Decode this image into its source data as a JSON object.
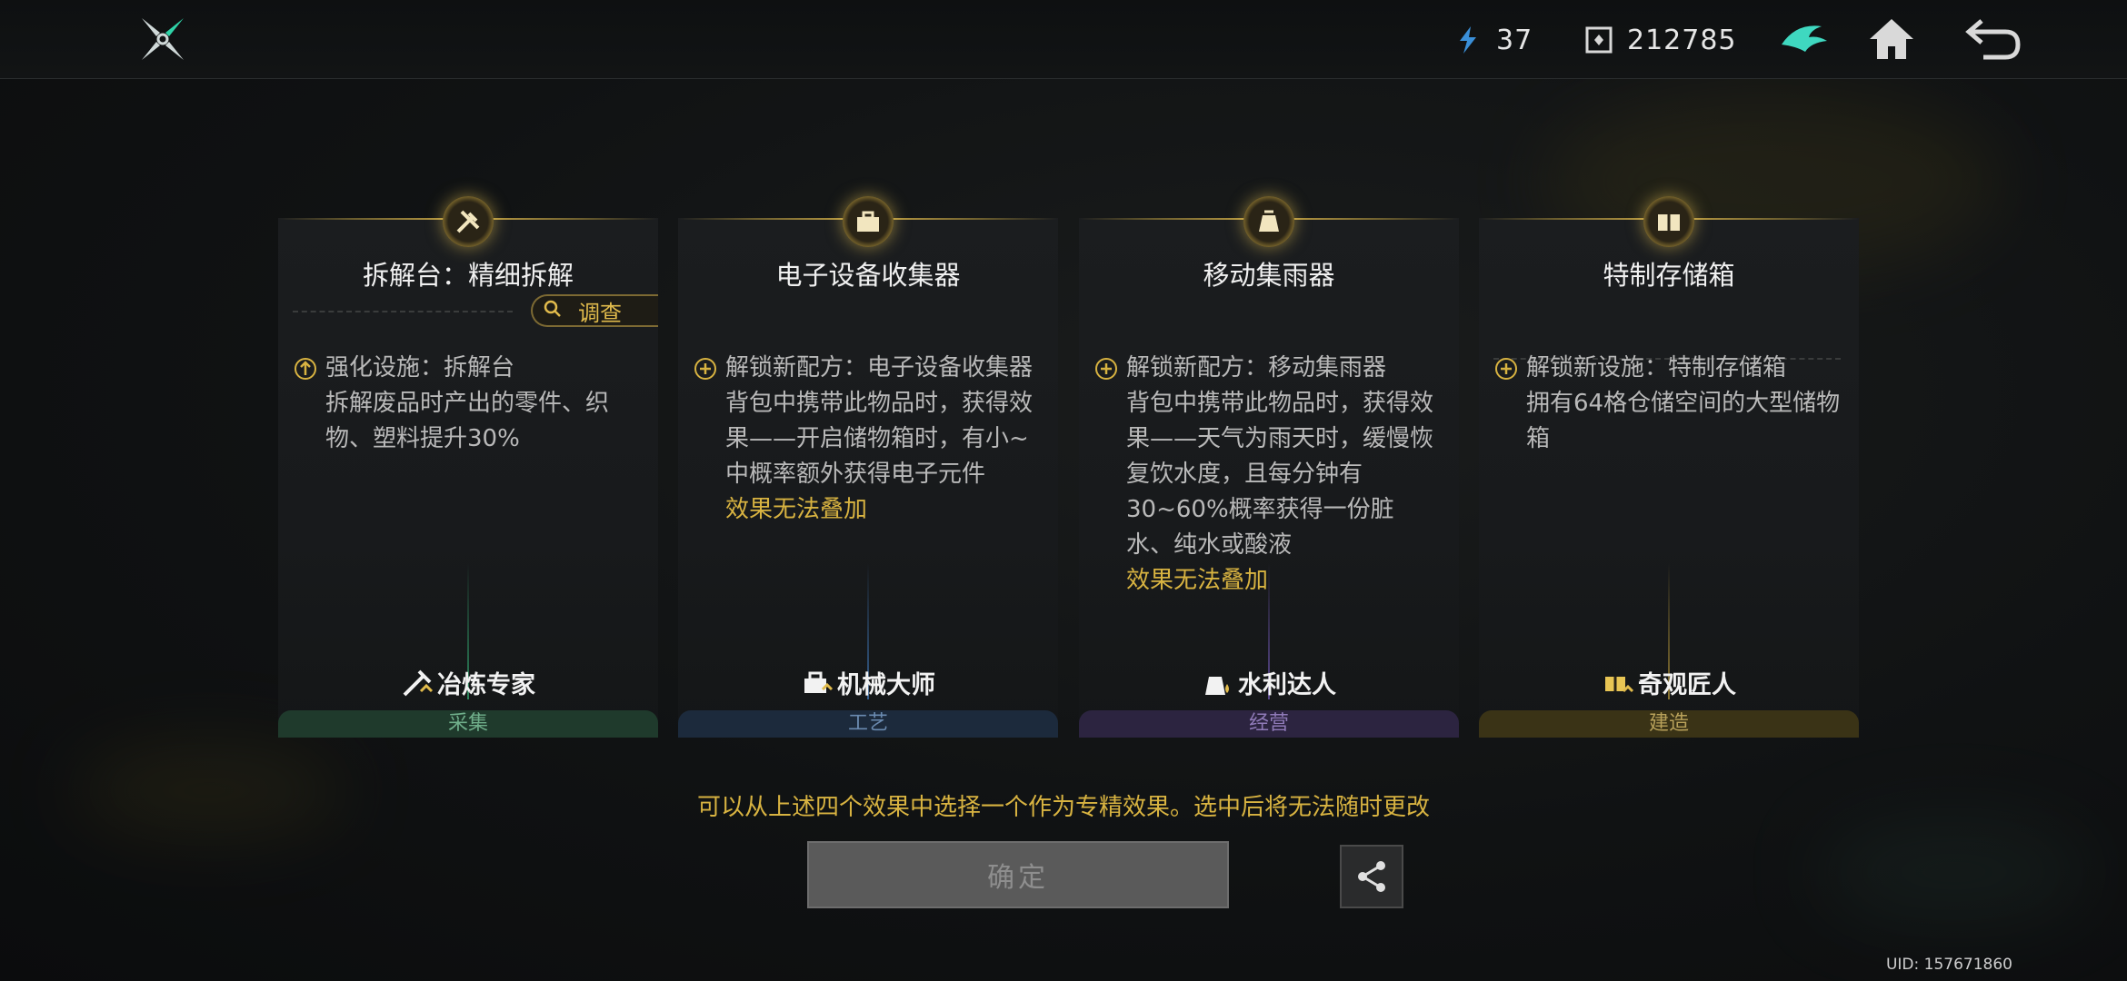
{
  "header": {
    "resources": [
      {
        "name": "energy",
        "icon": "lightning-crystal-icon",
        "value": "37"
      },
      {
        "name": "currency",
        "icon": "chip-currency-icon",
        "value": "212785"
      }
    ],
    "buttons": {
      "badge": "bird-emblem-icon",
      "home": "home-icon",
      "back": "return-arrow-icon"
    }
  },
  "cards": [
    {
      "title": "拆解台：精细拆解",
      "investigate_label": "调查",
      "effects": [
        {
          "text": "强化设施：拆解台\n拆解废品时产出的零件、织物、塑料提升30%"
        }
      ],
      "warning": "",
      "role": "冶炼专家",
      "category": "采集",
      "category_color": "#2f6b4b",
      "accent": "#3cd18a"
    },
    {
      "title": "电子设备收集器",
      "effects": [
        {
          "text": "解锁新配方：电子设备收集器\n背包中携带此物品时，获得效果——开启储物箱时，有小~中概率额外获得电子元件"
        }
      ],
      "warning": "效果无法叠加",
      "role": "机械大师",
      "category": "工艺",
      "category_color": "#2f4a6b",
      "accent": "#4a8fe0"
    },
    {
      "title": "移动集雨器",
      "effects": [
        {
          "text": "解锁新配方：移动集雨器\n背包中携带此物品时，获得效果——天气为雨天时，缓慢恢复饮水度，且每分钟有30~60%概率获得一份脏水、纯水或酸液"
        }
      ],
      "warning": "效果无法叠加",
      "role": "水利达人",
      "category": "经营",
      "category_color": "#4a3a6b",
      "accent": "#8a6ae0"
    },
    {
      "title": "特制存储箱",
      "effects": [
        {
          "text": "解锁新设施：特制存储箱\n拥有64格仓储空间的大型储物箱"
        }
      ],
      "warning": "",
      "role": "奇观匠人",
      "category": "建造",
      "category_color": "#5e5224",
      "accent": "#d8b341"
    }
  ],
  "hint": "可以从上述四个效果中选择一个作为专精效果。选中后将无法随时更改",
  "confirm_label": "确定",
  "share_icon": "share-icon",
  "uid": "UID: 157671860"
}
